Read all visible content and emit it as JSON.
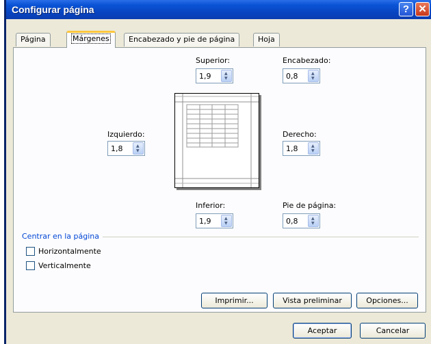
{
  "window": {
    "title": "Configurar página",
    "help_label": "?",
    "close_label": "✕"
  },
  "tabs": [
    {
      "label": "Página"
    },
    {
      "label": "Márgenes"
    },
    {
      "label": "Encabezado y pie de página"
    },
    {
      "label": "Hoja"
    }
  ],
  "margins": {
    "superior": {
      "label": "Superior:",
      "value": "1,9"
    },
    "encabezado": {
      "label": "Encabezado:",
      "value": "0,8"
    },
    "izquierdo": {
      "label": "Izquierdo:",
      "value": "1,8"
    },
    "derecho": {
      "label": "Derecho:",
      "value": "1,8"
    },
    "inferior": {
      "label": "Inferior:",
      "value": "1,9"
    },
    "pie": {
      "label": "Pie de página:",
      "value": "0,8"
    }
  },
  "center": {
    "title": "Centrar en la página",
    "horizontal": {
      "label": "Horizontalmente",
      "checked": false
    },
    "vertical": {
      "label": "Verticalmente",
      "checked": false
    }
  },
  "buttons": {
    "imprimir": "Imprimir...",
    "vista": "Vista preliminar",
    "opciones": "Opciones...",
    "aceptar": "Aceptar",
    "cancelar": "Cancelar"
  },
  "icons": {
    "spin_up": "spin-up-arrow-icon",
    "spin_down": "spin-down-arrow-icon"
  },
  "colors": {
    "titlebar": "#0b54d6",
    "dialog_bg": "#ece9d8",
    "section_title": "#0046d5",
    "active_tab_accent": "#ffc73c"
  }
}
